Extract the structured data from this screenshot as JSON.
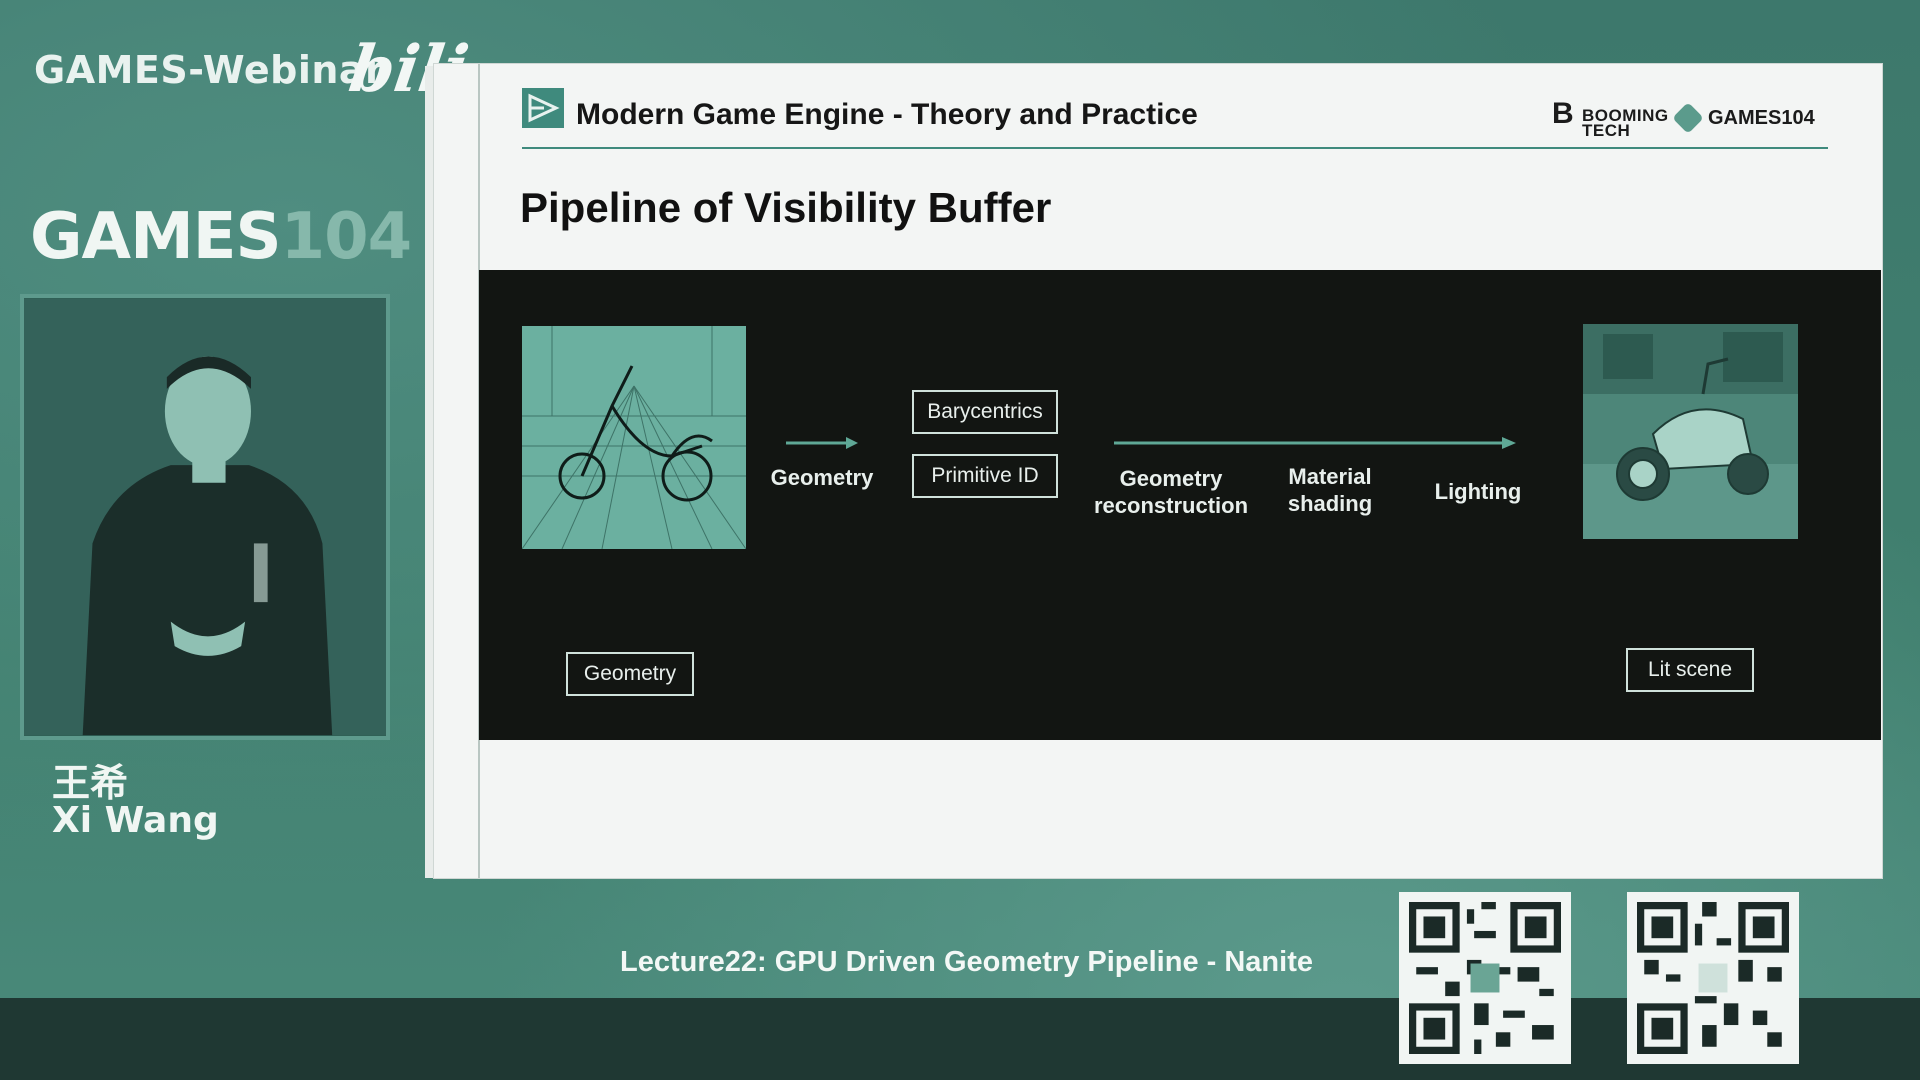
{
  "stream": {
    "brand": "GAMES-Webinar",
    "platform_logo": "bilibili",
    "course_logo": {
      "part1": "GAMES",
      "part2": "104"
    }
  },
  "speaker": {
    "name_cn": "王希",
    "name_en": "Xi Wang"
  },
  "slide": {
    "header_title": "Modern Game Engine - Theory and Practice",
    "brand_booming_mark": "B",
    "brand_booming_line1": "BOOMING",
    "brand_booming_line2": "TECH",
    "brand_games104": "GAMES104",
    "title": "Pipeline of Visibility Buffer",
    "diagram": {
      "geometry_arrow_label": "Geometry",
      "buffer_box_1": "Barycentrics",
      "buffer_box_2": "Primitive ID",
      "stage_1": "Geometry reconstruction",
      "stage_2": "Material shading",
      "stage_3": "Lighting",
      "left_caption": "Geometry",
      "right_caption": "Lit scene"
    }
  },
  "footer": {
    "lecture_title": "Lecture22: GPU Driven Geometry Pipeline - Nanite"
  },
  "colors": {
    "background_teal": "#3f7b70",
    "accent": "#3f8a7d",
    "diagram_bg": "#121512"
  }
}
